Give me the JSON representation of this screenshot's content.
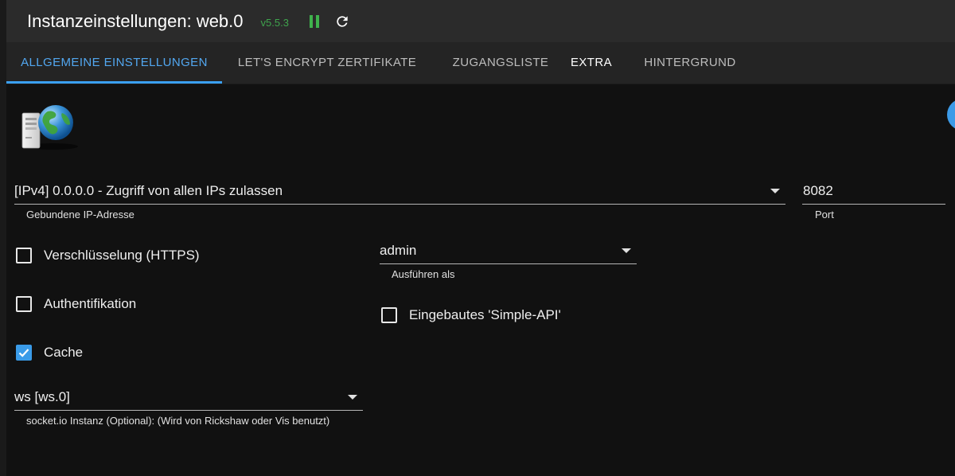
{
  "header": {
    "title": "Instanzeinstellungen: web.0",
    "version": "v5.5.3",
    "pause_icon": "pause-icon",
    "reload_icon": "reload-icon"
  },
  "tabs": [
    {
      "label": "ALLGEMEINE EINSTELLUNGEN",
      "active": true
    },
    {
      "label": "LET'S ENCRYPT ZERTIFIKATE",
      "active": false
    },
    {
      "label": "ZUGANGSLISTE",
      "active": false
    },
    {
      "label": "EXTRA",
      "active": false
    },
    {
      "label": "HINTERGRUND",
      "active": false
    }
  ],
  "form": {
    "bind_ip": {
      "value": "[IPv4] 0.0.0.0 - Zugriff von allen IPs zulassen",
      "helper": "Gebundene IP-Adresse"
    },
    "port": {
      "value": "8082",
      "helper": "Port"
    },
    "https": {
      "label": "Verschlüsselung (HTTPS)",
      "checked": false
    },
    "run_as": {
      "value": "admin",
      "helper": "Ausführen als"
    },
    "auth": {
      "label": "Authentifikation",
      "checked": false
    },
    "simple_api": {
      "label": "Eingebautes 'Simple-API'",
      "checked": false
    },
    "cache": {
      "label": "Cache",
      "checked": true
    },
    "socketio": {
      "value": "ws [ws.0]",
      "helper": "socket.io Instanz (Optional): (Wird von Rickshaw oder Vis benutzt)"
    }
  },
  "colors": {
    "accent": "#3ba0f2",
    "background": "#111111",
    "header": "#2b2b2b",
    "tabbar": "#242424",
    "running_green": "#3fb24c"
  }
}
